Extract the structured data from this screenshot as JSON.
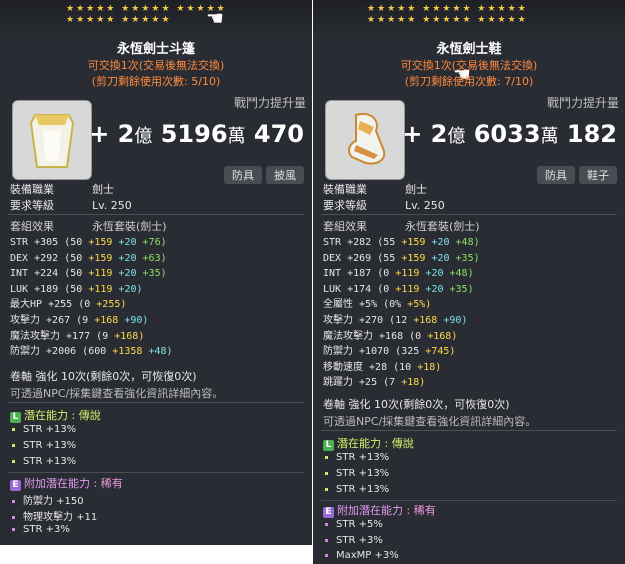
{
  "left": {
    "title": "永恆劍士斗篷",
    "trade": "可交換1次(交易後無法交換)",
    "scissors": "(剪刀剩餘使用次數: 5/10)",
    "cp_label": "戰鬥力提升量",
    "cp_value": {
      "plus": "+ 2",
      "u1": "億",
      "n2": "5196",
      "u2": "萬",
      "n3": "470"
    },
    "tags": [
      "防具",
      "披風"
    ],
    "job_label": "裝備職業",
    "job_value": "劍士",
    "req_label": "要求等級",
    "req_value": "Lv. 250",
    "set_label": "套組效果",
    "set_value": "永恆套裝(劍士)",
    "stats": [
      {
        "name": "STR",
        "total": "+305",
        "base": "(50",
        "a": "+159",
        "b": "+20",
        "c": "+76)"
      },
      {
        "name": "DEX",
        "total": "+292",
        "base": "(50",
        "a": "+159",
        "b": "+20",
        "c": "+63)"
      },
      {
        "name": "INT",
        "total": "+224",
        "base": "(50",
        "a": "+119",
        "b": "+20",
        "c": "+35)"
      },
      {
        "name": "LUK",
        "total": "+189",
        "base": "(50",
        "a": "+119",
        "b": "+20)",
        "c": ""
      },
      {
        "name": "最大HP",
        "total": "+255",
        "base": "(0",
        "a": "+255)",
        "b": "",
        "c": ""
      },
      {
        "name": "攻擊力",
        "total": "+267",
        "base": "(9",
        "a": "+168",
        "b": "+90)",
        "c": ""
      },
      {
        "name": "魔法攻擊力",
        "total": "+177",
        "base": "(9",
        "a": "+168)",
        "b": "",
        "c": ""
      },
      {
        "name": "防禦力",
        "total": "+2006",
        "base": "(600",
        "a": "+1358",
        "b": "+48)",
        "c": ""
      }
    ],
    "scroll": "卷軸 強化 10次(剩餘0次，可恢復0次)",
    "hint": "可透過NPC/採集鍵查看強化資訊詳細內容。",
    "potential_label": "潛在能力 : ",
    "potential_grade": "傳說",
    "potential_lines": [
      "STR +13%",
      "STR +13%",
      "STR +13%"
    ],
    "bonus_label": "附加潛在能力 : ",
    "bonus_grade": "稀有",
    "bonus_lines": [
      "防禦力 +150",
      "物理攻擊力 +11",
      "STR +3%"
    ]
  },
  "right": {
    "title": "永恆劍士鞋",
    "trade": "可交換1次(交易後無法交換)",
    "scissors": "(剪刀剩餘使用次數: 7/10)",
    "cp_label": "戰鬥力提升量",
    "cp_value": {
      "plus": "+ 2",
      "u1": "億",
      "n2": "6033",
      "u2": "萬",
      "n3": "182"
    },
    "tags": [
      "防具",
      "鞋子"
    ],
    "job_label": "裝備職業",
    "job_value": "劍士",
    "req_label": "要求等級",
    "req_value": "Lv. 250",
    "set_label": "套組效果",
    "set_value": "永恆套裝(劍士)",
    "stats": [
      {
        "name": "STR",
        "total": "+282",
        "base": "(55",
        "a": "+159",
        "b": "+20",
        "c": "+48)"
      },
      {
        "name": "DEX",
        "total": "+269",
        "base": "(55",
        "a": "+159",
        "b": "+20",
        "c": "+35)"
      },
      {
        "name": "INT",
        "total": "+187",
        "base": "(0",
        "a": "+119",
        "b": "+20",
        "c": "+48)"
      },
      {
        "name": "LUK",
        "total": "+174",
        "base": "(0",
        "a": "+119",
        "b": "+20",
        "c": "+35)"
      },
      {
        "name": "全屬性",
        "total": "+5%",
        "base": "(0%",
        "a": "+5%)",
        "b": "",
        "c": ""
      },
      {
        "name": "攻擊力",
        "total": "+270",
        "base": "(12",
        "a": "+168",
        "b": "+90)",
        "c": ""
      },
      {
        "name": "魔法攻擊力",
        "total": "+168",
        "base": "(0",
        "a": "+168)",
        "b": "",
        "c": ""
      },
      {
        "name": "防禦力",
        "total": "+1070",
        "base": "(325",
        "a": "+745)",
        "b": "",
        "c": ""
      },
      {
        "name": "移動速度",
        "total": "+28",
        "base": "(10",
        "a": "+18)",
        "b": "",
        "c": ""
      },
      {
        "name": "跳躍力",
        "total": "+25",
        "base": "(7",
        "a": "+18)",
        "b": "",
        "c": ""
      }
    ],
    "scroll": "卷軸 強化 10次(剩餘0次，可恢復0次)",
    "hint": "可透過NPC/採集鍵查看強化資訊詳細內容。",
    "potential_label": "潛在能力 : ",
    "potential_grade": "傳說",
    "potential_lines": [
      "STR +13%",
      "STR +13%",
      "STR +13%"
    ],
    "bonus_label": "附加潛在能力 : ",
    "bonus_grade": "稀有",
    "bonus_lines": [
      "STR +5%",
      "STR +3%",
      "MaxMP +3%"
    ]
  },
  "colors": {
    "accent_orange": "#ff8a3c",
    "legend": "#d6f06a",
    "rare": "#e09af0",
    "bg": "#2a2c33"
  }
}
